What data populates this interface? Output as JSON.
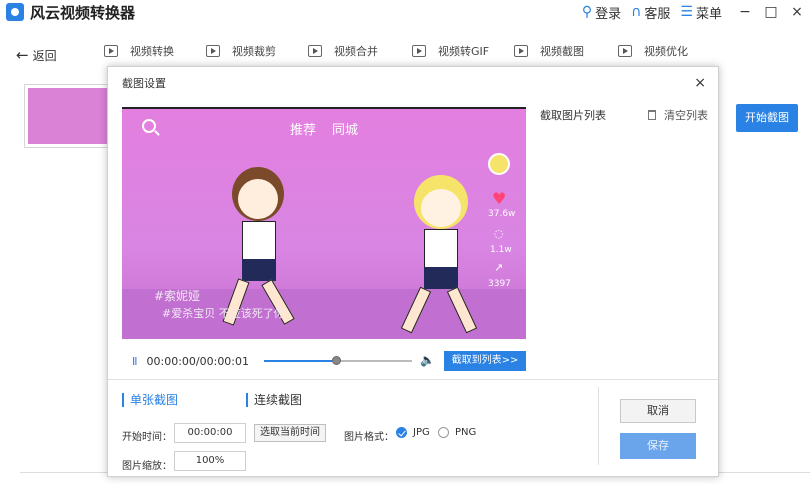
{
  "app": {
    "title": "风云视频转换器",
    "login_label": "登录",
    "service_label": "客服",
    "menu_label": "菜单",
    "minimize_glyph": "−",
    "maximize_glyph": "□",
    "close_glyph": "×"
  },
  "toolbar": {
    "back_label": "返回",
    "tools": [
      {
        "label": "视频转换",
        "icon": "play-file-icon"
      },
      {
        "label": "视频裁剪",
        "icon": "crop-file-icon"
      },
      {
        "label": "视频合并",
        "icon": "merge-file-icon"
      },
      {
        "label": "视频转GIF",
        "icon": "gif-icon"
      },
      {
        "label": "视频截图",
        "icon": "screenshot-icon"
      },
      {
        "label": "视频优化",
        "icon": "sliders-icon"
      }
    ]
  },
  "background": {
    "start_capture_label": "开始截图"
  },
  "dialog": {
    "title": "截图设置",
    "close_glyph": "×",
    "video": {
      "tab_recommend": "推荐",
      "tab_city": "同城",
      "likes": "37.6w",
      "comments": "1.1w",
      "shares": "3397",
      "caption_line1": "#索妮娅",
      "caption_line2": "#爱杀宝贝 不应该死了你"
    },
    "player": {
      "pause_glyph": "II",
      "time": "00:00:00/00:00:01",
      "progress_percent": 48,
      "volume_glyph": "🔈",
      "capture_to_list_label": "截取到列表>>"
    },
    "list": {
      "header": "截取图片列表",
      "clear_label": "清空列表"
    },
    "options": {
      "single_tab": "单张截图",
      "continuous_tab": "连续截图",
      "start_time_label": "开始时间：",
      "start_time_value": "00:00:00",
      "pick_current_label": "选取当前时间",
      "format_label": "图片格式：",
      "format_jpg": "JPG",
      "format_png": "PNG",
      "scale_label": "图片缩放：",
      "scale_value": "100%"
    },
    "cancel_label": "取消",
    "save_label": "保存"
  },
  "colors": {
    "accent": "#2a82e4",
    "video_bg": "#e37fe0"
  }
}
